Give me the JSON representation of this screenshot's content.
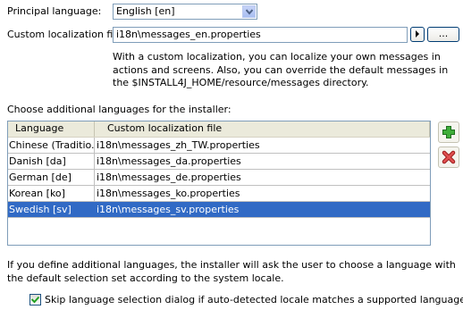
{
  "principal_language": {
    "label": "Principal language:",
    "selected": "English [en]"
  },
  "custom_localization": {
    "label": "Custom localization file:",
    "value": "i18n\\messages_en.properties",
    "browse_label": "..."
  },
  "description": "With a custom localization, you can localize your own messages in actions and screens. Also, you can override the default messages in the $INSTALL4J_HOME/resource/messages directory.",
  "additional": {
    "label": "Choose additional languages for the installer:",
    "columns": [
      "Language",
      "Custom localization file"
    ],
    "rows": [
      {
        "language": "Chinese (Traditio...",
        "file": "i18n\\messages_zh_TW.properties",
        "selected": false
      },
      {
        "language": "Danish [da]",
        "file": "i18n\\messages_da.properties",
        "selected": false
      },
      {
        "language": "German [de]",
        "file": "i18n\\messages_de.properties",
        "selected": false
      },
      {
        "language": "Korean [ko]",
        "file": "i18n\\messages_ko.properties",
        "selected": false
      },
      {
        "language": "Swedish [sv]",
        "file": "i18n\\messages_sv.properties",
        "selected": true
      }
    ]
  },
  "note": "If you define additional languages, the installer will ask the user to choose a language with the default selection set according to the system locale.",
  "skip_option": {
    "label": "Skip language selection dialog if auto-detected locale matches a supported language",
    "checked": true
  },
  "icons": {
    "add": "plus-icon",
    "remove": "delete-x-icon",
    "combo": "chevron-down-icon",
    "arrow": "triangle-right-icon"
  },
  "colors": {
    "selection": "#316ac5",
    "add_green": "#2f9a2f",
    "remove_red": "#d23c3c"
  }
}
